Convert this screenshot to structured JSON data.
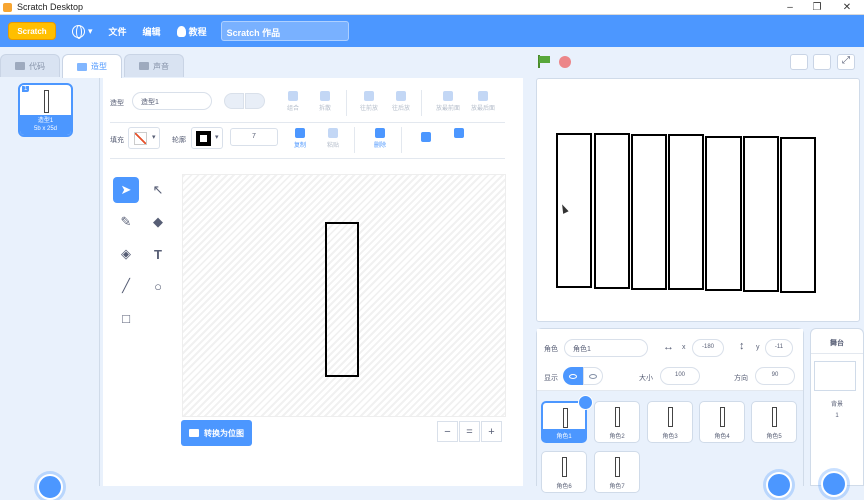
{
  "window": {
    "title": "Scratch Desktop",
    "controls": [
      "–",
      "❐",
      "✕"
    ]
  },
  "menu": {
    "logo": "Scratch",
    "file": "文件",
    "edit": "编辑",
    "tutorials": "教程",
    "project_title": "Scratch 作品"
  },
  "tabs": [
    {
      "label": "代码",
      "icon": "code-icon",
      "active": false
    },
    {
      "label": "造型",
      "icon": "brush-icon",
      "active": true
    },
    {
      "label": "声音",
      "icon": "speaker-icon",
      "active": false
    }
  ],
  "costume_list": [
    {
      "number": "1",
      "name": "造型1",
      "size": "5b x 25d"
    }
  ],
  "editor": {
    "costume_label": "造型",
    "costume_name": "造型1",
    "buttons": {
      "group": "组合",
      "ungroup": "拆散",
      "forward": "往前放",
      "backward": "往后放",
      "front": "放最前面",
      "back": "放最后面",
      "copy": "复制",
      "paste": "粘贴",
      "delete": "删除"
    },
    "fill_label": "填充",
    "outline_label": "轮廓",
    "outline_width": "7",
    "convert_button": "转换为位图",
    "zoom_out": "−",
    "zoom_reset": "=",
    "zoom_in": "+"
  },
  "sprite_info": {
    "sprite_label": "角色",
    "sprite_name": "角色1",
    "x_label": "x",
    "x_value": "-180",
    "y_label": "y",
    "y_value": "-11",
    "show_label": "显示",
    "size_label": "大小",
    "size_value": "100",
    "direction_label": "方向",
    "direction_value": "90"
  },
  "sprites": [
    {
      "name": "角色1",
      "selected": true
    },
    {
      "name": "角色2",
      "selected": false
    },
    {
      "name": "角色3",
      "selected": false
    },
    {
      "name": "角色4",
      "selected": false
    },
    {
      "name": "角色5",
      "selected": false
    },
    {
      "name": "角色6",
      "selected": false
    },
    {
      "name": "角色7",
      "selected": false
    }
  ],
  "stage_pane": {
    "title": "舞台",
    "backdrops_label": "背景",
    "backdrops_count": "1"
  },
  "colors": {
    "accent": "#4c97ff",
    "menubar": "#4c97ff",
    "background": "#e9f1fc"
  }
}
